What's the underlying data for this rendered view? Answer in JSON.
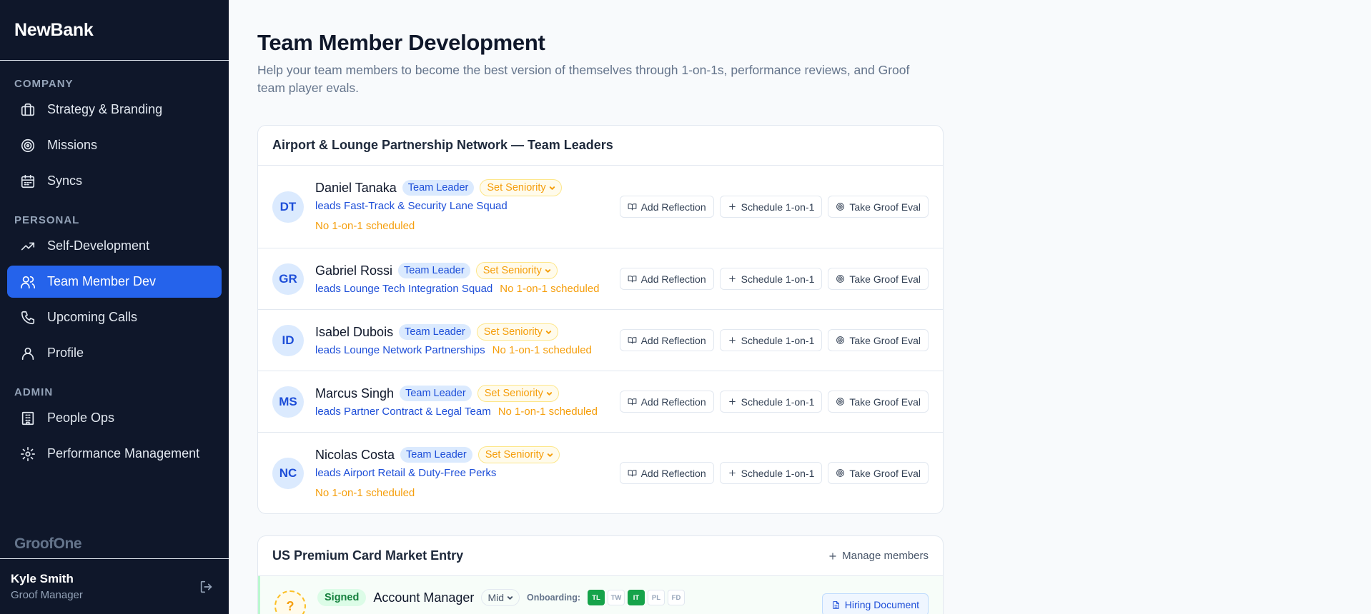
{
  "app": {
    "brand": "NewBank",
    "footer_brand": "GroofOne"
  },
  "sidebar": {
    "sections": [
      {
        "label": "COMPANY",
        "items": [
          {
            "label": "Strategy & Branding",
            "icon": "briefcase-icon"
          },
          {
            "label": "Missions",
            "icon": "target-icon"
          },
          {
            "label": "Syncs",
            "icon": "calendar-icon"
          }
        ]
      },
      {
        "label": "PERSONAL",
        "items": [
          {
            "label": "Self-Development",
            "icon": "trending-up-icon"
          },
          {
            "label": "Team Member Dev",
            "icon": "users-icon",
            "active": true
          },
          {
            "label": "Upcoming Calls",
            "icon": "phone-icon"
          },
          {
            "label": "Profile",
            "icon": "user-icon"
          }
        ]
      },
      {
        "label": "ADMIN",
        "items": [
          {
            "label": "People Ops",
            "icon": "building-icon"
          },
          {
            "label": "Performance Management",
            "icon": "gear-icon"
          }
        ]
      }
    ]
  },
  "user": {
    "name": "Kyle Smith",
    "role": "Groof Manager"
  },
  "page": {
    "title": "Team Member Development",
    "description": "Help your team members to become the best version of themselves through 1-on-1s, performance reviews, and Groof team player evals."
  },
  "leaders_card": {
    "title": "Airport & Lounge Partnership Network — Team Leaders",
    "badge": "Team Leader",
    "seniority_label": "Set Seniority",
    "no_call_label": "No 1-on-1 scheduled",
    "actions": {
      "reflection": "Add Reflection",
      "schedule": "Schedule 1-on-1",
      "eval": "Take Groof Eval"
    },
    "members": [
      {
        "initials": "DT",
        "name": "Daniel Tanaka",
        "lead": "leads Fast-Track & Security Lane Squad"
      },
      {
        "initials": "GR",
        "name": "Gabriel Rossi",
        "lead": "leads Lounge Tech Integration Squad"
      },
      {
        "initials": "ID",
        "name": "Isabel Dubois",
        "lead": "leads Lounge Network Partnerships"
      },
      {
        "initials": "MS",
        "name": "Marcus Singh",
        "lead": "leads Partner Contract & Legal Team"
      },
      {
        "initials": "NC",
        "name": "Nicolas Costa",
        "lead": "leads Airport Retail & Duty-Free Perks"
      }
    ]
  },
  "second_card": {
    "title": "US Premium Card Market Entry",
    "manage_label": "Manage members",
    "hire": {
      "avatar": "?",
      "status": "Signed",
      "role": "Account Manager",
      "level": "Mid",
      "onboarding_label": "Onboarding:",
      "steps": [
        {
          "label": "TL",
          "done": true
        },
        {
          "label": "TW",
          "done": false
        },
        {
          "label": "IT",
          "done": true
        },
        {
          "label": "PL",
          "done": false
        },
        {
          "label": "FD",
          "done": false
        }
      ],
      "doc_label": "Hiring Document"
    }
  },
  "colors": {
    "sidebar_bg": "#0f172a",
    "accent": "#2563eb",
    "warning": "#f59e0b",
    "success": "#16a34a"
  }
}
